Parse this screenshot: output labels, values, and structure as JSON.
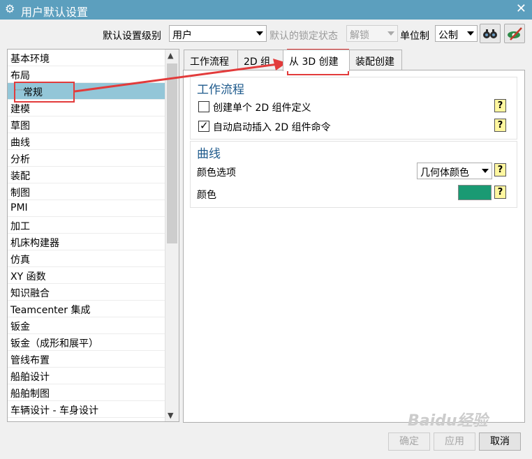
{
  "window": {
    "title": "用户默认设置",
    "close_glyph": "✕",
    "gear_glyph": "⚙"
  },
  "toolbar": {
    "default_level_label": "默认设置级别",
    "default_level_value": "用户",
    "lock_state_label": "默认的锁定状态",
    "lock_state_value": "解锁",
    "unit_label": "单位制",
    "unit_value": "公制",
    "search_icon": "binoculars-icon",
    "manage_icon": "manage-defaults-icon"
  },
  "tree": {
    "items": [
      "基本环境",
      "布局",
      "常规",
      "建模",
      "草图",
      "曲线",
      "分析",
      "装配",
      "制图",
      "PMI",
      "加工",
      "机床构建器",
      "仿真",
      "XY 函数",
      "知识融合",
      "Teamcenter 集成",
      "钣金",
      "钣金（成形和展平）",
      "管线布置",
      "船舶设计",
      "船舶制图",
      "车辆设计 - 车身设计"
    ],
    "selected": "常规",
    "tree_dots": "····"
  },
  "tabs": [
    "工作流程",
    "2D 组",
    "从 3D 创建",
    "装配创建"
  ],
  "active_tab": "从 3D 创建",
  "workflow_group": {
    "title": "工作流程",
    "options": [
      {
        "label": "创建单个 2D 组件定义",
        "checked": false
      },
      {
        "label": "自动启动插入 2D 组件命令",
        "checked": true
      }
    ],
    "check_mark": "✓"
  },
  "curve_group": {
    "title": "曲线",
    "color_option_label": "颜色选项",
    "color_option_value": "几何体颜色",
    "color_label": "颜色",
    "color_value": "#1a9a73"
  },
  "help_glyph": "?",
  "footer": {
    "ok": "确定",
    "apply": "应用",
    "cancel": "取消"
  },
  "watermark": "Baidu经验",
  "accent_colors": {
    "titlebar": "#5c9fbe",
    "selection": "#93c6d8",
    "annotation": "#e23b3b",
    "group_title": "#1e5a8c"
  }
}
